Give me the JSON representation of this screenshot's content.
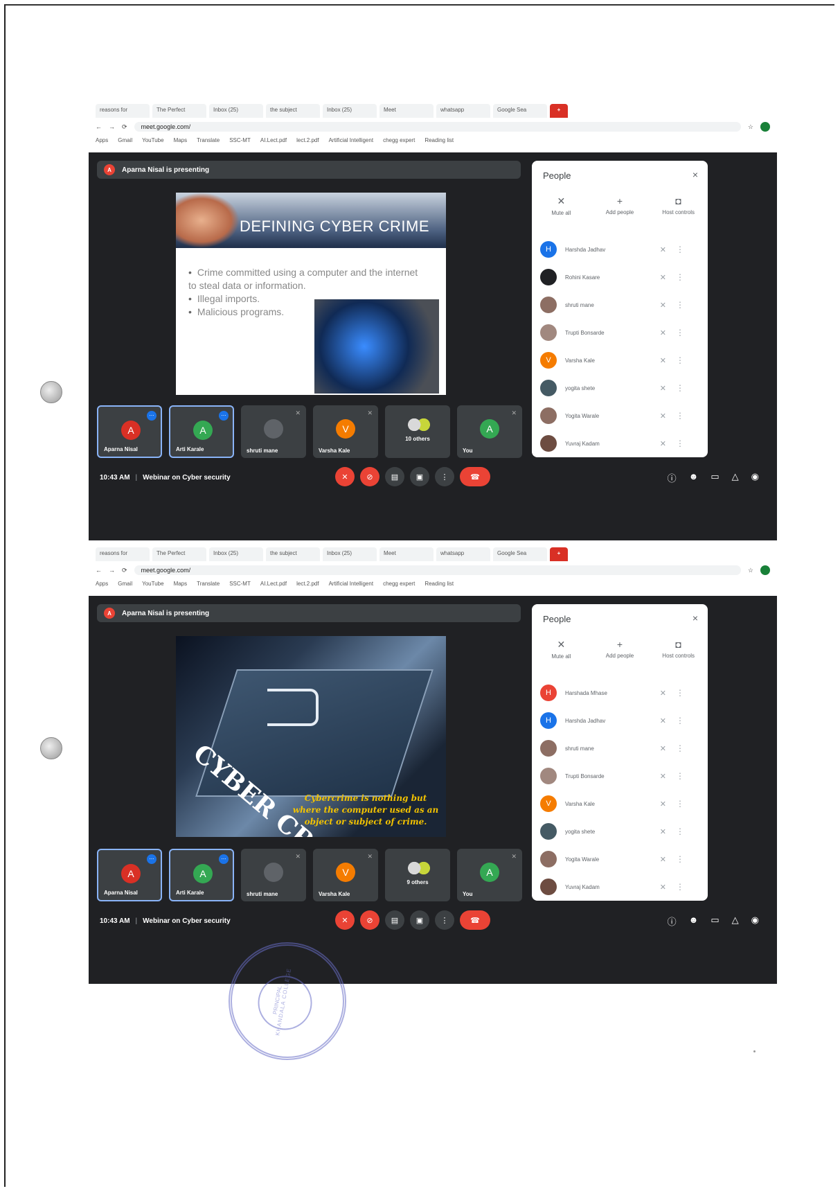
{
  "tabs": [
    "reasons for",
    "The Perfect",
    "Inbox (25)",
    "the subject",
    "Inbox (25)",
    "Meet",
    "whatsapp",
    "Google Sea"
  ],
  "new_tab_label": "+",
  "address": "meet.google.com/",
  "bookmarks": [
    "Apps",
    "Gmail",
    "YouTube",
    "Maps",
    "Translate",
    "SSC-MT",
    "AI.Lect.pdf",
    "lect.2.pdf",
    "Artificial Intelligent",
    "chegg expert"
  ],
  "reading_list": "Reading list",
  "screens": [
    {
      "presenter_banner": "Aparna Nisal is presenting",
      "slide_title": "DEFINING CYBER CRIME",
      "bullets": [
        "Crime committed using a computer and the internet to steal data or information.",
        "Illegal imports.",
        "Malicious programs."
      ],
      "tiles": [
        {
          "initial": "A",
          "name": "Aparna Nisal",
          "color": "#d93025",
          "active": true
        },
        {
          "initial": "A",
          "name": "Arti Karale",
          "color": "#34a853",
          "active": true
        },
        {
          "initial": "",
          "name": "shruti mane",
          "color": "#5f6368",
          "active": false
        },
        {
          "initial": "V",
          "name": "Varsha Kale",
          "color": "#f57c00",
          "active": false
        },
        {
          "initial": "",
          "name": "10 others",
          "color": "#3c4043",
          "active": false,
          "others": true
        },
        {
          "initial": "A",
          "name": "You",
          "color": "#34a853",
          "active": false
        }
      ],
      "people": [
        {
          "initial": "H",
          "name": "Harshda Jadhav",
          "color": "#1a73e8"
        },
        {
          "initial": "",
          "name": "Rohini Kasare",
          "color": "#202124"
        },
        {
          "initial": "",
          "name": "shruti mane",
          "color": "#8d6e63"
        },
        {
          "initial": "",
          "name": "Trupti Bonsarde",
          "color": "#a1887f"
        },
        {
          "initial": "V",
          "name": "Varsha Kale",
          "color": "#f57c00"
        },
        {
          "initial": "",
          "name": "yogita shete",
          "color": "#455a64"
        },
        {
          "initial": "",
          "name": "Yogita Warale",
          "color": "#8d6e63"
        },
        {
          "initial": "",
          "name": "Yuvraj Kadam",
          "color": "#6d4c41"
        }
      ],
      "time": "10:43 AM",
      "meeting_name": "Webinar on Cyber security"
    },
    {
      "presenter_banner": "Aparna Nisal is presenting",
      "slide_cover_text": "CYBER CRIME",
      "slide_quote": "Cybercrime is nothing but where the computer used as an object or subject of crime.",
      "tiles": [
        {
          "initial": "A",
          "name": "Aparna Nisal",
          "color": "#d93025",
          "active": true
        },
        {
          "initial": "A",
          "name": "Arti Karale",
          "color": "#34a853",
          "active": true
        },
        {
          "initial": "",
          "name": "shruti mane",
          "color": "#5f6368",
          "active": false
        },
        {
          "initial": "V",
          "name": "Varsha Kale",
          "color": "#f57c00",
          "active": false
        },
        {
          "initial": "",
          "name": "9 others",
          "color": "#3c4043",
          "active": false,
          "others": true
        },
        {
          "initial": "A",
          "name": "You",
          "color": "#34a853",
          "active": false
        }
      ],
      "people": [
        {
          "initial": "H",
          "name": "Harshada Mhase",
          "color": "#ea4335"
        },
        {
          "initial": "H",
          "name": "Harshda Jadhav",
          "color": "#1a73e8"
        },
        {
          "initial": "",
          "name": "shruti mane",
          "color": "#8d6e63"
        },
        {
          "initial": "",
          "name": "Trupti Bonsarde",
          "color": "#a1887f"
        },
        {
          "initial": "V",
          "name": "Varsha Kale",
          "color": "#f57c00"
        },
        {
          "initial": "",
          "name": "yogita shete",
          "color": "#455a64"
        },
        {
          "initial": "",
          "name": "Yogita Warale",
          "color": "#8d6e63"
        },
        {
          "initial": "",
          "name": "Yuvraj Kadam",
          "color": "#6d4c41"
        }
      ],
      "time": "10:43 AM",
      "meeting_name": "Webinar on Cyber security"
    }
  ],
  "people_panel": {
    "title": "People",
    "close": "×",
    "mute_all": "Mute all",
    "add_people": "Add people",
    "host_controls": "Host controls"
  },
  "stamp": {
    "ring_text": "KHANDALA COLLEGE",
    "center_text": "PRINCIPAL"
  }
}
